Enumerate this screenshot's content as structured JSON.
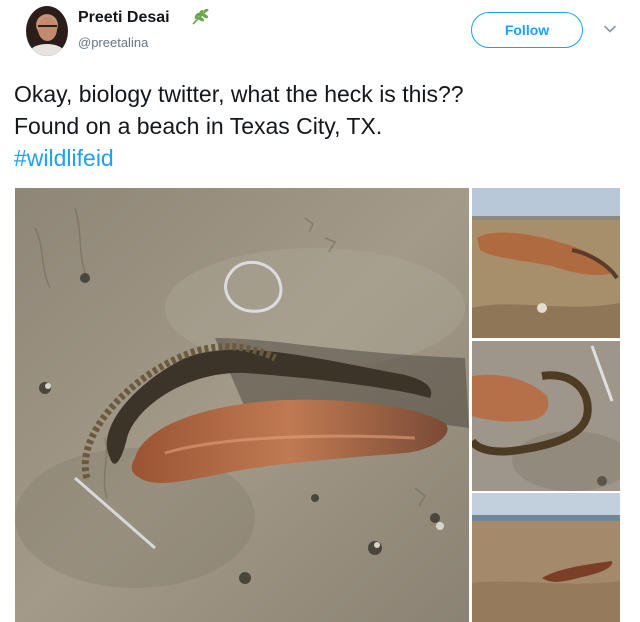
{
  "user": {
    "display_name": "Preeti Desai",
    "handle": "@preetalina"
  },
  "follow_button_label": "Follow",
  "tweet": {
    "line1": "Okay, biology twitter, what the heck is this??",
    "line2": "Found on a beach in Texas City, TX.",
    "hashtag": "#wildlifeid"
  },
  "icons": {
    "name_badge": "leaf-sprig-icon",
    "menu": "chevron-down-icon"
  },
  "colors": {
    "accent": "#1da1f2",
    "text": "#14171a",
    "secondary_text": "#657786",
    "leaf": "#6aa84f"
  }
}
